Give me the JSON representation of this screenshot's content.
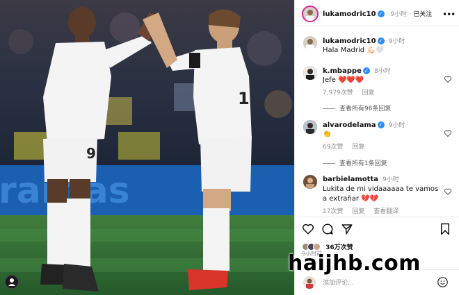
{
  "post": {
    "author": "lukamodric10",
    "time": "9小时",
    "follow_status": "已关注",
    "more_icon": "more-horizontal-icon"
  },
  "caption": {
    "author": "lukamodric10",
    "time": "9小时",
    "text": "Hala Madrid 💪🏻🤍"
  },
  "comments": [
    {
      "user": "k.mbappe",
      "verified": true,
      "time": "8小时",
      "text": "Jefe ❤️❤️❤️",
      "likes": "7,979次赞",
      "reply": "回复",
      "view_replies": "查看所有96条回复"
    },
    {
      "user": "alvarodelama",
      "verified": true,
      "time": "9小时",
      "text": "👏",
      "likes": "69次赞",
      "reply": "回复",
      "view_replies": "查看所有1条回复"
    },
    {
      "user": "barbielamotta",
      "verified": false,
      "time": "9小时",
      "text": "Lukita de mi vidaaaaaa te vamos a extrañar 💔💔",
      "likes": "17次赞",
      "reply": "回复",
      "translate": "查看翻译"
    }
  ],
  "actions": {
    "like_icon": "heart-icon",
    "comment_icon": "comment-icon",
    "share_icon": "send-icon",
    "save_icon": "bookmark-icon"
  },
  "likes_summary": "36万次赞",
  "post_time": "9小时前",
  "comment_input": {
    "placeholder": "添加评论..."
  },
  "watermark": "haijhb.com",
  "colors": {
    "verified": "#2f8df5",
    "kit": "#f4f4f4",
    "pitch": "#2e6b35",
    "ad_board": "#1a5fb0"
  }
}
